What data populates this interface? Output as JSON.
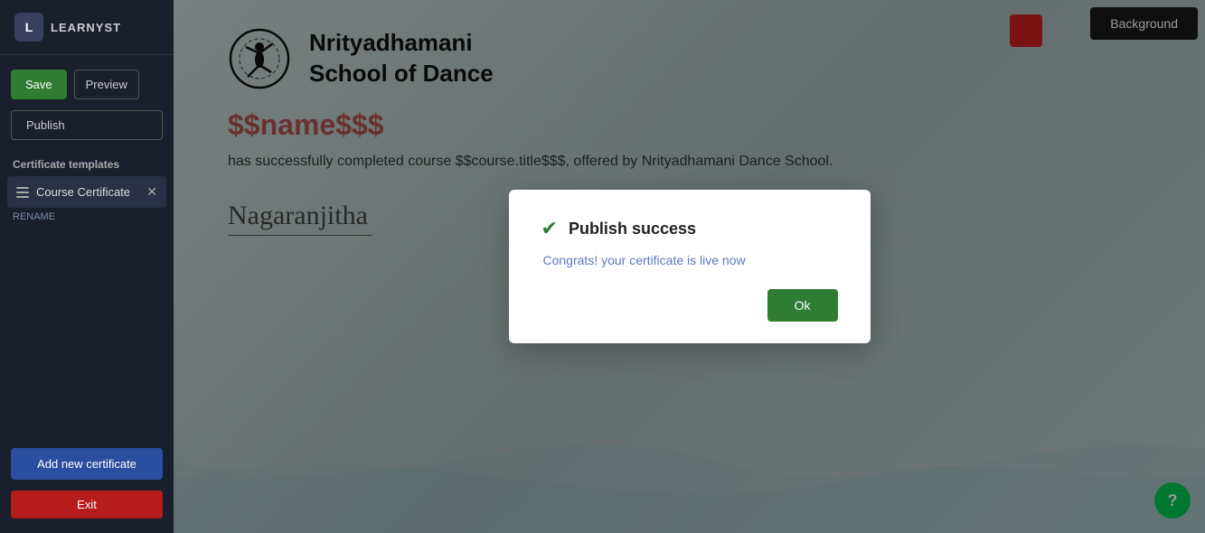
{
  "sidebar": {
    "logo_letter": "L",
    "logo_name": "LEARNYST",
    "save_label": "Save",
    "preview_label": "Preview",
    "publish_label": "Publish",
    "cert_templates_label": "Certificate templates",
    "cert_item_label": "Course Certificate",
    "rename_label": "RENAME",
    "add_cert_label": "Add new certificate",
    "exit_label": "Exit"
  },
  "toolbar": {
    "background_label": "Background"
  },
  "certificate": {
    "school_name_line1": "Nrityadhamani",
    "school_name_line2": "School of Dance",
    "recipient_placeholder": "$$name$$$",
    "completion_text": "has successfully completed course $$course.title$$$, offered by Nrityadhamani Dance School.",
    "signature_text": "Nagaranjitha"
  },
  "modal": {
    "title": "Publish success",
    "body": "Congrats! your certificate is live now",
    "ok_label": "Ok"
  },
  "help": {
    "icon": "?"
  }
}
